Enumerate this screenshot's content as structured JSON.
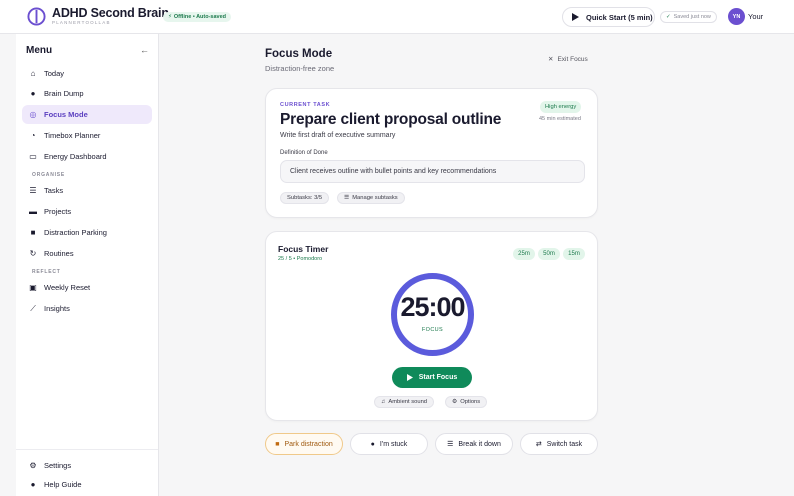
{
  "app": {
    "title": "ADHD Second Brain",
    "subtitle": "PLANNERTOOLLAB",
    "status_badge": "Offline • Auto-saved",
    "quick_start_label": "Quick Start (5 min)",
    "saved_label": "Saved just now",
    "user_initials": "YN",
    "user_name": "Your"
  },
  "sidebar": {
    "title": "Menu",
    "items": [
      {
        "label": "Today",
        "icon": "home-icon"
      },
      {
        "label": "Brain Dump",
        "icon": "lightbulb-icon"
      },
      {
        "label": "Focus Mode",
        "icon": "target-icon",
        "active": true
      },
      {
        "label": "Timebox Planner",
        "icon": "clock-icon"
      },
      {
        "label": "Energy Dashboard",
        "icon": "battery-icon"
      }
    ],
    "organise_label": "ORGANISE",
    "organise_items": [
      {
        "label": "Tasks",
        "icon": "list-icon"
      },
      {
        "label": "Projects",
        "icon": "folder-icon"
      },
      {
        "label": "Distraction Parking",
        "icon": "parking-icon"
      },
      {
        "label": "Routines",
        "icon": "refresh-icon"
      }
    ],
    "reflect_label": "REFLECT",
    "reflect_items": [
      {
        "label": "Weekly Reset",
        "icon": "calendar-icon"
      },
      {
        "label": "Insights",
        "icon": "chart-icon"
      }
    ],
    "footer_items": [
      {
        "label": "Settings",
        "icon": "gear-icon"
      },
      {
        "label": "Help Guide",
        "icon": "help-icon"
      }
    ]
  },
  "main": {
    "title": "Focus Mode",
    "subtitle": "Distraction-free zone",
    "exit_label": "Exit Focus",
    "task": {
      "section_label": "CURRENT TASK",
      "title": "Prepare client proposal outline",
      "description": "Write first draft of executive summary",
      "energy": "High energy",
      "estimate": "45 min estimated",
      "dod_label": "Definition of Done",
      "dod_value": "Client receives outline with bullet points and key recommendations",
      "subtasks": "Subtasks: 3/5",
      "manage_subtasks": "Manage subtasks"
    },
    "timer": {
      "title": "Focus Timer",
      "subtitle": "25 / 5 • Pomodoro",
      "presets": [
        "25m",
        "50m",
        "15m"
      ],
      "time": "25:00",
      "mode": "FOCUS",
      "start_label": "Start Focus",
      "ambient_label": "Ambient sound",
      "options_label": "Options"
    },
    "actions": {
      "park": "Park distraction",
      "stuck": "I'm stuck",
      "break_down": "Break it down",
      "switch": "Switch task"
    }
  },
  "colors": {
    "accent": "#6b4fd0",
    "ring": "#5b5bdc",
    "success": "#0f8a5a"
  }
}
